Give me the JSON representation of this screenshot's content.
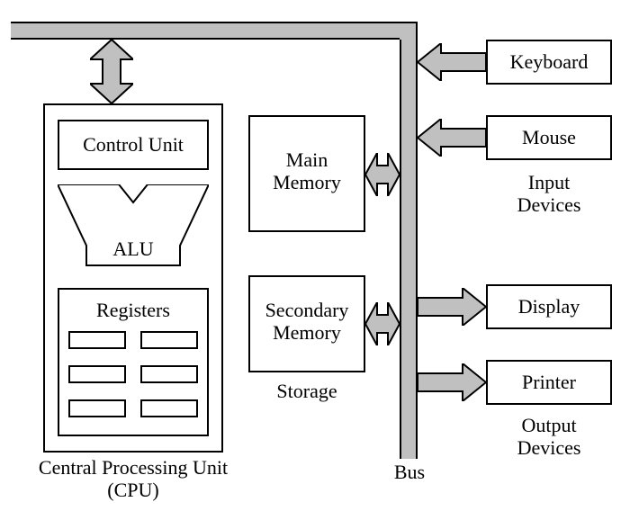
{
  "cpu": {
    "caption": "Central Processing Unit\n(CPU)",
    "control_unit": "Control Unit",
    "alu": "ALU",
    "registers": "Registers"
  },
  "storage": {
    "main_memory": "Main\nMemory",
    "secondary_memory": "Secondary\nMemory",
    "caption": "Storage"
  },
  "bus": {
    "caption": "Bus"
  },
  "input_devices": {
    "keyboard": "Keyboard",
    "mouse": "Mouse",
    "caption": "Input\nDevices"
  },
  "output_devices": {
    "display": "Display",
    "printer": "Printer",
    "caption": "Output\nDevices"
  }
}
